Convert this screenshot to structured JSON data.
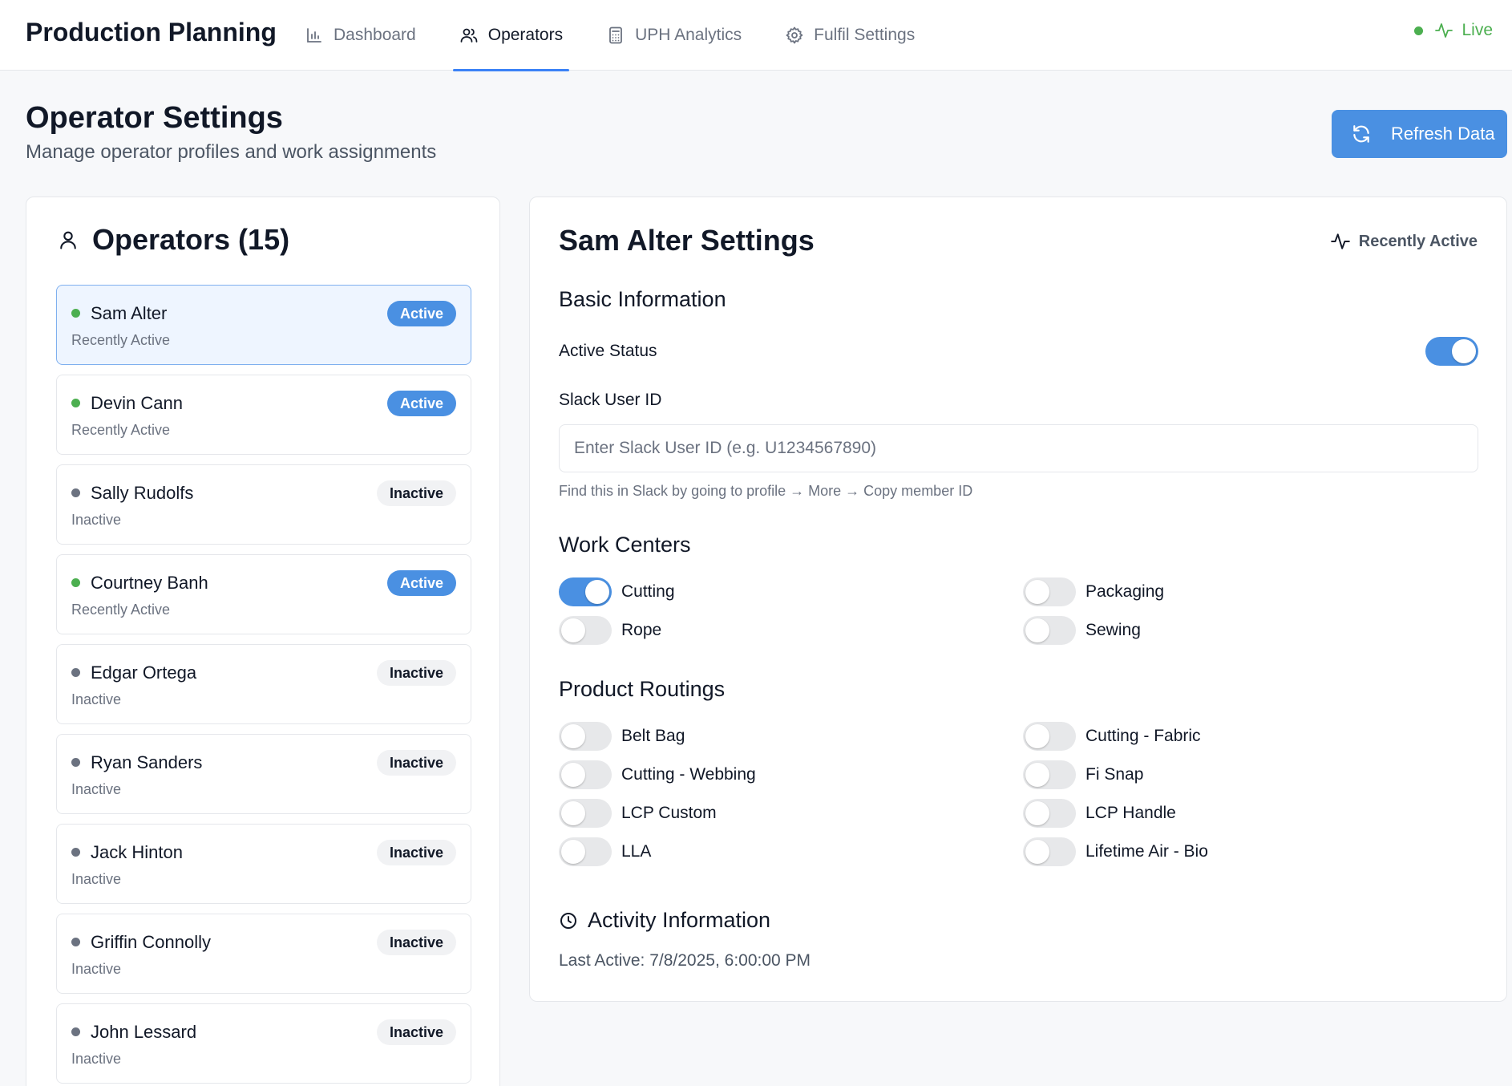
{
  "header": {
    "brand": "Production Planning",
    "tabs": [
      {
        "label": "Dashboard",
        "icon": "bar-chart-icon",
        "active": false
      },
      {
        "label": "Operators",
        "icon": "users-icon",
        "active": true
      },
      {
        "label": "UPH Analytics",
        "icon": "calculator-icon",
        "active": false
      },
      {
        "label": "Fulfil Settings",
        "icon": "gear-icon",
        "active": false
      }
    ],
    "live_label": "Live"
  },
  "page": {
    "title": "Operator Settings",
    "subtitle": "Manage operator profiles and work assignments",
    "refresh_label": "Refresh Data"
  },
  "operators_panel": {
    "title": "Operators (15)",
    "items": [
      {
        "name": "Sam Alter",
        "status": "Recently Active",
        "badge": "Active",
        "active": true,
        "selected": true
      },
      {
        "name": "Devin Cann",
        "status": "Recently Active",
        "badge": "Active",
        "active": true,
        "selected": false
      },
      {
        "name": "Sally Rudolfs",
        "status": "Inactive",
        "badge": "Inactive",
        "active": false,
        "selected": false
      },
      {
        "name": "Courtney Banh",
        "status": "Recently Active",
        "badge": "Active",
        "active": true,
        "selected": false
      },
      {
        "name": "Edgar Ortega",
        "status": "Inactive",
        "badge": "Inactive",
        "active": false,
        "selected": false
      },
      {
        "name": "Ryan Sanders",
        "status": "Inactive",
        "badge": "Inactive",
        "active": false,
        "selected": false
      },
      {
        "name": "Jack Hinton",
        "status": "Inactive",
        "badge": "Inactive",
        "active": false,
        "selected": false
      },
      {
        "name": "Griffin Connolly",
        "status": "Inactive",
        "badge": "Inactive",
        "active": false,
        "selected": false
      },
      {
        "name": "John Lessard",
        "status": "Inactive",
        "badge": "Inactive",
        "active": false,
        "selected": false
      }
    ]
  },
  "settings": {
    "title": "Sam Alter Settings",
    "recent_label": "Recently Active",
    "basic_title": "Basic Information",
    "active_status_label": "Active Status",
    "active_status_on": true,
    "slack_label": "Slack User ID",
    "slack_value": "",
    "slack_placeholder": "Enter Slack User ID (e.g. U1234567890)",
    "slack_hint": "Find this in Slack by going to profile → More → Copy member ID",
    "work_centers_title": "Work Centers",
    "work_centers": [
      {
        "label": "Cutting",
        "on": true
      },
      {
        "label": "Packaging",
        "on": false
      },
      {
        "label": "Rope",
        "on": false
      },
      {
        "label": "Sewing",
        "on": false
      }
    ],
    "routings_title": "Product Routings",
    "routings": [
      {
        "label": "Belt Bag",
        "on": false
      },
      {
        "label": "Cutting - Fabric",
        "on": false
      },
      {
        "label": "Cutting - Webbing",
        "on": false
      },
      {
        "label": "Fi Snap",
        "on": false
      },
      {
        "label": "LCP Custom",
        "on": false
      },
      {
        "label": "LCP Handle",
        "on": false
      },
      {
        "label": "LLA",
        "on": false
      },
      {
        "label": "Lifetime Air - Bio",
        "on": false
      }
    ],
    "activity_title": "Activity Information",
    "last_active": "Last Active: 7/8/2025, 6:00:00 PM"
  },
  "colors": {
    "accent": "#4a90e2",
    "tab_underline": "#3b82f6",
    "live_green": "#4caf50",
    "active_dot": "#4caf50",
    "inactive_dot": "#6b7280",
    "selected_bg": "#eef5ff"
  }
}
